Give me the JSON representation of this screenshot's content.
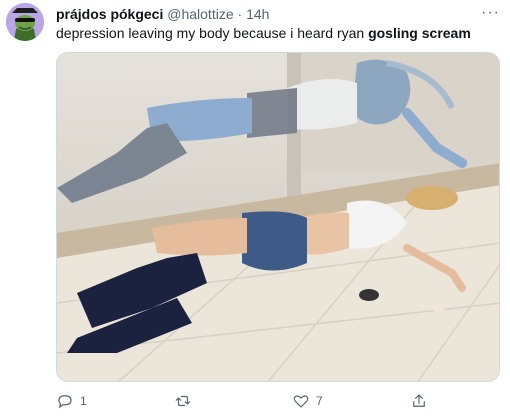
{
  "tweet": {
    "display_name": "prájdos pókgeci",
    "handle": "@halottize",
    "separator": "·",
    "time": "14h",
    "more_label": "···",
    "text_before": "depression leaving my body because i heard ryan ",
    "text_highlight": "gosling scream"
  },
  "actions": {
    "reply_count": "1",
    "retweet_count": "",
    "like_count": "7"
  },
  "icons": {
    "reply": "reply-icon",
    "retweet": "retweet-icon",
    "like": "heart-icon",
    "share": "share-icon"
  },
  "colors": {
    "secondary_text": "#536471",
    "avatar_bg": "#b9a6e4"
  }
}
